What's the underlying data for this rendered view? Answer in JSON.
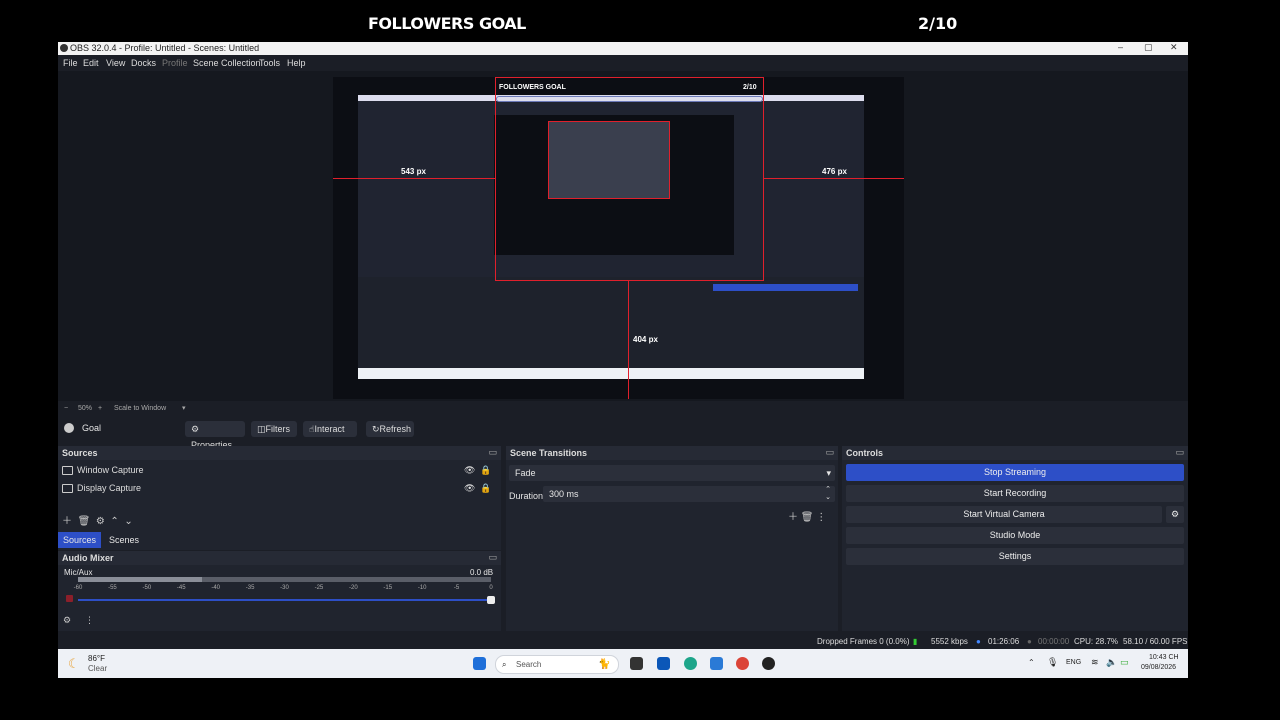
{
  "overlay": {
    "goal_title": "FOLLOWERS GOAL",
    "goal_count": "2/10",
    "goal_progress": 0.2
  },
  "window": {
    "title": "OBS 32.0.4 - Profile: Untitled - Scenes: Untitled",
    "controls": {
      "minimize": "–",
      "maximize": "▢",
      "close": "✕"
    }
  },
  "menu": [
    "File",
    "Edit",
    "View",
    "Docks",
    "Profile",
    "Scene Collection",
    "Tools",
    "Help"
  ],
  "preview": {
    "measure_left": "543 px",
    "measure_right": "476 px",
    "measure_bottom": "404 px",
    "inner_goal_title": "FOLLOWERS GOAL",
    "inner_goal_count": "2/10"
  },
  "zoom": {
    "level": "50%",
    "mode": "Scale to Window"
  },
  "toolbar": {
    "source_name": "Goal",
    "properties": "Properties",
    "filters": "Filters",
    "interact": "Interact",
    "refresh": "Refresh"
  },
  "sources": {
    "title": "Sources",
    "items": [
      {
        "label": "Window Capture"
      },
      {
        "label": "Display Capture"
      }
    ],
    "tabs": [
      "Sources",
      "Scenes"
    ]
  },
  "mixer": {
    "title": "Audio Mixer",
    "channel": "Mic/Aux",
    "level": "0.0 dB",
    "ticks": [
      "-60",
      "-55",
      "-50",
      "-45",
      "-40",
      "-35",
      "-30",
      "-25",
      "-20",
      "-15",
      "-10",
      "-5",
      "0"
    ]
  },
  "transitions": {
    "title": "Scene Transitions",
    "selected": "Fade",
    "duration_label": "Duration",
    "duration_value": "300 ms"
  },
  "controls": {
    "title": "Controls",
    "stop_streaming": "Stop Streaming",
    "start_recording": "Start Recording",
    "start_virtual_camera": "Start Virtual Camera",
    "studio_mode": "Studio Mode",
    "settings": "Settings"
  },
  "status": {
    "dropped": "Dropped Frames 0 (0.0%)",
    "bitrate": "5552 kbps",
    "stream_time": "01:26:06",
    "rec_time": "00:00:00",
    "cpu": "CPU: 28.7%",
    "fps": "58.10 / 60.00 FPS"
  },
  "taskbar": {
    "weather_temp": "86°F",
    "weather_desc": "Clear",
    "search_placeholder": "Search",
    "language": "ENG",
    "time": "10:43 CH",
    "date": "09/08/2026"
  },
  "colors": {
    "accent": "#2d4fc7",
    "red_guides": "#e0202c"
  }
}
